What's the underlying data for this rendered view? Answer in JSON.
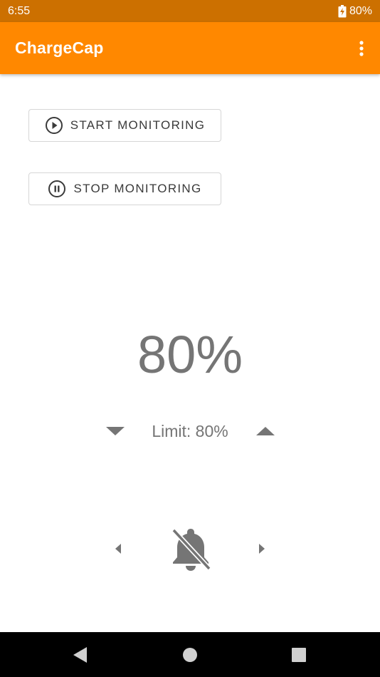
{
  "status_bar": {
    "time": "6:55",
    "battery_percent": "80%"
  },
  "app_bar": {
    "title": "ChargeCap"
  },
  "buttons": {
    "start_label": "START MONITORING",
    "stop_label": "STOP MONITORING"
  },
  "charge": {
    "percent_display": "80%",
    "limit_label": "Limit: 80%"
  },
  "icons": {
    "battery": "battery-charging-icon",
    "overflow": "more-vert-icon",
    "start": "play-circle-icon",
    "stop": "pause-circle-icon",
    "decrease": "arrow-drop-down-icon",
    "increase": "arrow-drop-up-icon",
    "prev": "arrow-left-icon",
    "next": "arrow-right-icon",
    "notifications": "notifications-off-icon",
    "nav_back": "nav-back-icon",
    "nav_home": "nav-home-icon",
    "nav_recents": "nav-recents-icon"
  },
  "colors": {
    "status_bar": "#cc7000",
    "app_bar": "#ff8800",
    "text_gray": "#757575"
  }
}
